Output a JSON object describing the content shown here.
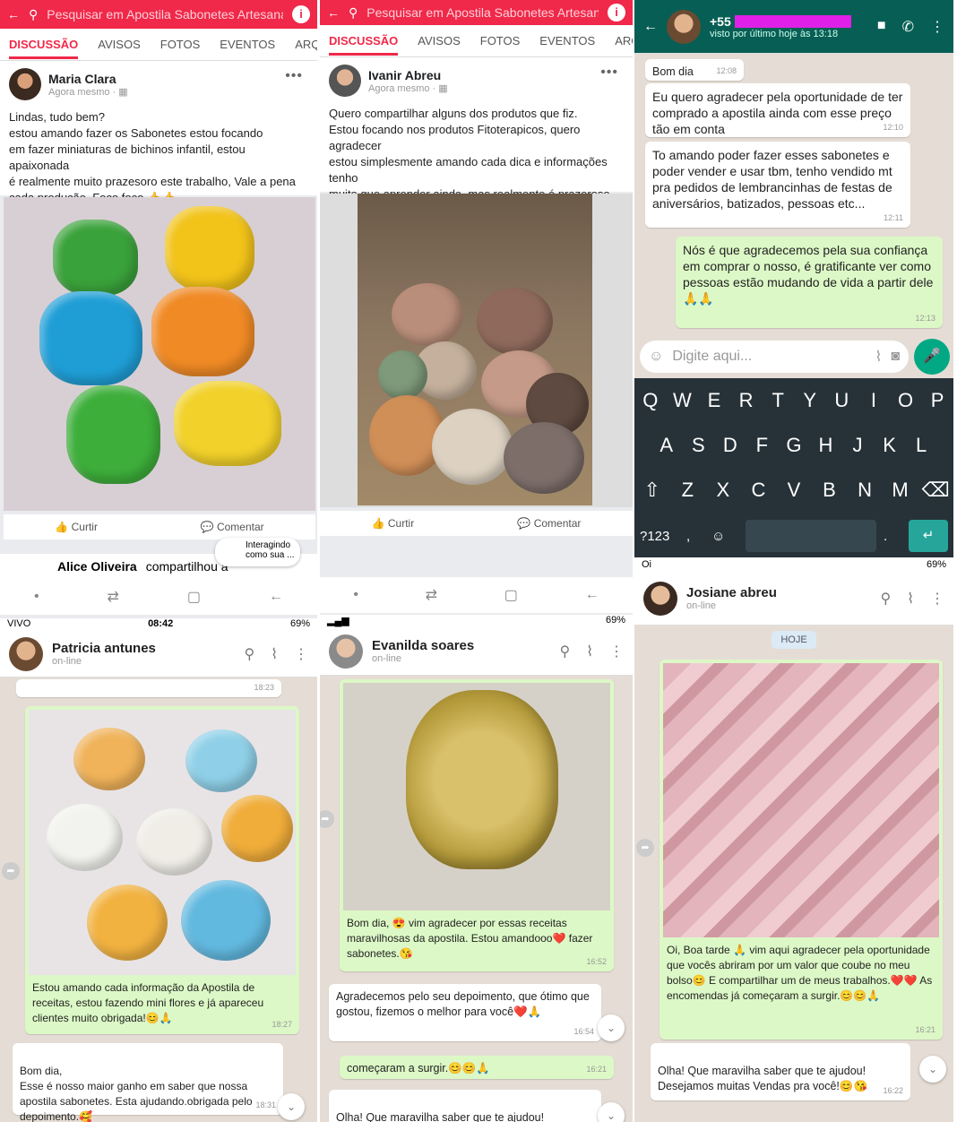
{
  "fb": {
    "search_placeholder": "Pesquisar em Apostila Sabonetes Artesanais",
    "info_icon": "i",
    "tabs": [
      "DISCUSSÃO",
      "AVISOS",
      "FOTOS",
      "EVENTOS",
      "ARQUIV"
    ],
    "like_label": "Curtir",
    "comment_label": "Comentar",
    "post1": {
      "name": "Maria Clara",
      "time": "Agora mesmo · ▦",
      "text": "Lindas, tudo bem?\nestou amando fazer os Sabonetes estou focando\nem fazer miniaturas de bichinos infantil, estou apaixonada\né realmente muito prazesoro este trabalho, Vale a pena\ncada produção. Foco foco 👍👍"
    },
    "post2": {
      "name": "Ivanir Abreu",
      "time": "Agora mesmo · ▦",
      "text": "Quero compartilhar alguns dos produtos que fiz.\nEstou focando nos produtos Fitoterapicos, quero agradecer\nestou simplesmente amando cada dica e informações tenho\nmuito que aprender ainda, mas realmente é prazeroso\nfazer aquilo que gostamos."
    },
    "next_post": {
      "name": "Alice Oliveira",
      "text": "compartilhou a"
    },
    "interacting": "Interagindo como sua ..."
  },
  "wa_top": {
    "contact": "+55",
    "last_seen": "visto por último hoje às 13:18",
    "messages": [
      {
        "text": "Bom dia",
        "time": "12:08"
      },
      {
        "text": "Eu quero agradecer pela oportunidade de ter comprado a apostila ainda com esse preço tão em conta",
        "time": "12:10"
      },
      {
        "text": "To amando poder fazer esses sabonetes e poder vender e usar tbm, tenho vendido mt pra pedidos de lembrancinhas de festas de aniversários, batizados, pessoas etc...",
        "time": "12:11"
      },
      {
        "text": "Nós é que agradecemos pela sua confiança em comprar o nosso, é gratificante ver como pessoas estão mudando de vida a partir dele 🙏🙏",
        "time": "12:13"
      }
    ],
    "input_placeholder": "Digite aqui...",
    "keys_row1": [
      "Q",
      "W",
      "E",
      "R",
      "T",
      "Y",
      "U",
      "I",
      "O",
      "P"
    ],
    "keys_row2": [
      "A",
      "S",
      "D",
      "F",
      "G",
      "H",
      "J",
      "K",
      "L"
    ],
    "keys_row3": [
      "Z",
      "X",
      "C",
      "V",
      "B",
      "N",
      "M"
    ],
    "sym_key": "?123"
  },
  "wa1": {
    "status_carrier": "VIVO",
    "status_time": "08:42",
    "status_battery": "69%",
    "name": "Patricia antunes",
    "sub": "on-line",
    "top_time": "18:23",
    "caption": "Estou amando cada informação da Apostila de receitas, estou fazendo mini flores e já apareceu clientes muito obrigada!😊🙏",
    "caption_time": "18:27",
    "reply": "Bom dia,\nEsse é nosso maior ganho em saber que nossa apostila sabonetes. Esta ajudando.obrigada pelo depoimento.🥰",
    "reply_time": "18:31"
  },
  "wa2": {
    "status_battery": "69%",
    "name": "Evanilda soares",
    "sub": "on-line",
    "caption": "Bom dia, 😍 vim agradecer por essas receitas maravilhosas da apostila. Estou amandooo❤️ fazer sabonetes.😘",
    "caption_time": "16:52",
    "reply": "Agradecemos pelo seu depoimento, que ótimo que gostou, fizemos o melhor para você❤️🙏",
    "reply_time": "16:54",
    "msg3": "começaram a surgir.😊😊🙏",
    "msg3_time": "16:21",
    "msg4": "Olha! Que maravilha saber que te ajudou!\nDesejamos muitas Vendas pra você!😊😘"
  },
  "wa3": {
    "carrier": "Oi",
    "status_battery": "69%",
    "name": "Josiane abreu",
    "sub": "on-line",
    "date_chip": "HOJE",
    "caption": "Oi, Boa tarde 🙏 vim aqui agradecer pela oportunidade que vocês abriram por um valor que coube no meu bolso😊 E compartilhar um de meus trabalhos.❤️❤️ As encomendas já começaram a surgir.😊😊🙏",
    "caption_time": "16:21",
    "reply": "Olha! Que maravilha saber que te ajudou!\nDesejamos muitas Vendas pra você!😊😘",
    "reply_time": "16:22"
  }
}
